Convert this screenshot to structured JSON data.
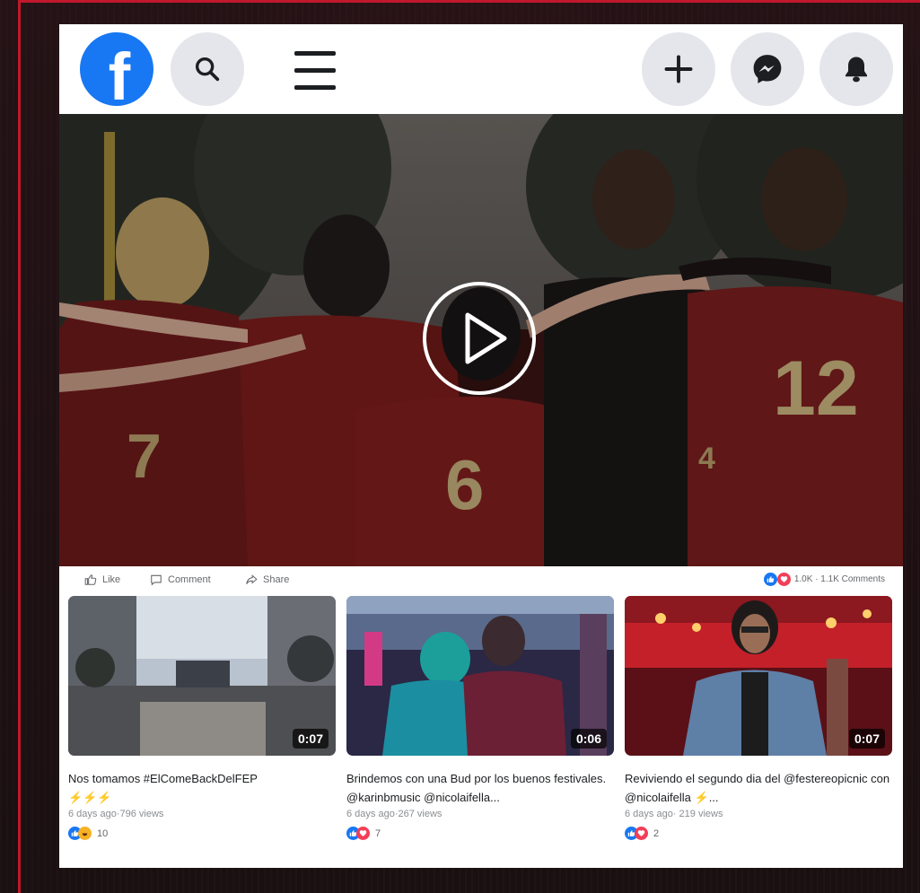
{
  "colors": {
    "accent_frame": "#c0182c",
    "facebook_blue": "#1877f2",
    "love_red": "#f33e58"
  },
  "header": {
    "logo_letter": "f",
    "icons": [
      "facebook-logo-icon",
      "search-icon",
      "menu-icon",
      "plus-icon",
      "messenger-icon",
      "bell-icon"
    ]
  },
  "video": {
    "icon": "play-icon",
    "jersey_numbers": [
      "7",
      "6",
      "12",
      "4"
    ]
  },
  "actions": {
    "like": "Like",
    "comment": "Comment",
    "share": "Share",
    "reactions_summary": "1.0K · 1.1K Comments"
  },
  "related": [
    {
      "duration": "0:07",
      "title": "Nos tomamos #ElComeBackDelFEP",
      "emoji_line": "⚡⚡⚡",
      "meta": "6 days ago·796 views",
      "reaction_count": "10",
      "reactions": [
        "like",
        "haha"
      ]
    },
    {
      "duration": "0:06",
      "title": "Brindemos con una Bud por los buenos festivales. @karinbmusic @nicolaifella...",
      "emoji_line": "",
      "meta": "6 days ago·267 views",
      "reaction_count": "7",
      "reactions": [
        "like",
        "love"
      ]
    },
    {
      "duration": "0:07",
      "title": "Reviviendo el segundo dia del @festereopicnic con @nicolaifella ⚡...",
      "emoji_line": "",
      "meta": "6 days ago· 219 views",
      "reaction_count": "2",
      "reactions": [
        "like",
        "love"
      ]
    }
  ]
}
